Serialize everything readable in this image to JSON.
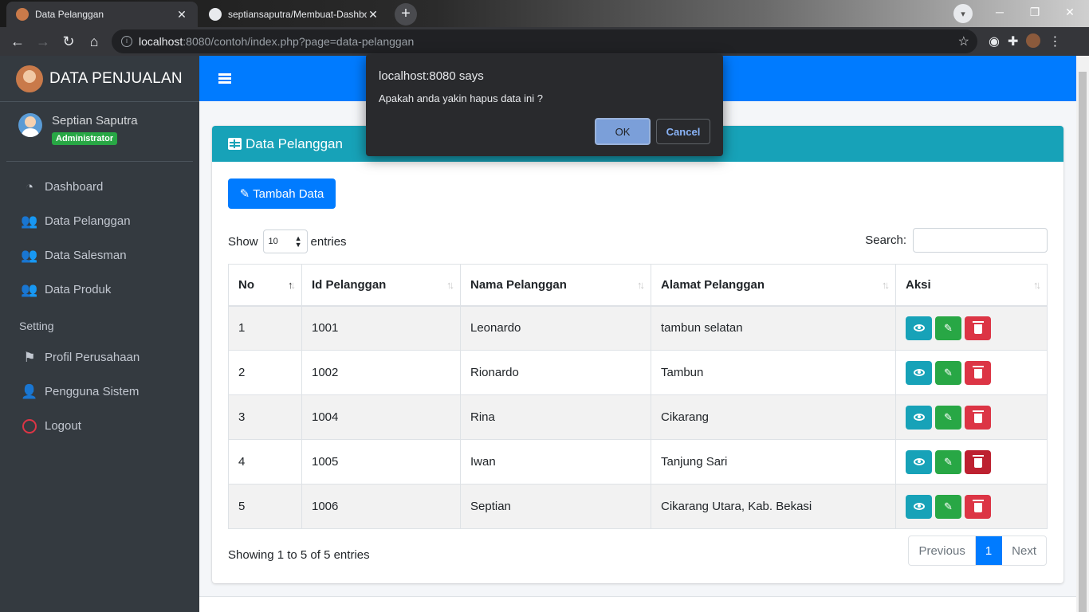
{
  "browser": {
    "tabs": [
      {
        "title": "Data Pelanggan",
        "active": true
      },
      {
        "title": "septiansaputra/Membuat-Dashbo",
        "active": false
      }
    ],
    "new_tab_symbol": "+",
    "url_host": "localhost",
    "url_rest": ":8080/contoh/index.php?page=data-pelanggan"
  },
  "sidebar": {
    "brand": "DATA PENJUALAN",
    "user_name": "Septian Saputra",
    "user_role": "Administrator",
    "menu": [
      {
        "label": "Dashboard",
        "icon": "tachometer-icon"
      },
      {
        "label": "Data Pelanggan",
        "icon": "users-icon"
      },
      {
        "label": "Data Salesman",
        "icon": "users-icon"
      },
      {
        "label": "Data Produk",
        "icon": "users-icon"
      }
    ],
    "setting_header": "Setting",
    "setting_menu": [
      {
        "label": "Profil Perusahaan",
        "icon": "flag-icon"
      },
      {
        "label": "Pengguna Sistem",
        "icon": "user-icon"
      },
      {
        "label": "Logout",
        "icon": "circle-icon"
      }
    ]
  },
  "card": {
    "title": "Data Pelanggan",
    "add_button": "Tambah Data",
    "show_label": "Show",
    "entries_value": "10",
    "entries_label": "entries",
    "search_label": "Search:",
    "search_value": "",
    "columns": [
      "No",
      "Id Pelanggan",
      "Nama Pelanggan",
      "Alamat Pelanggan",
      "Aksi"
    ],
    "rows": [
      {
        "no": "1",
        "id": "1001",
        "nama": "Leonardo",
        "alamat": "tambun selatan"
      },
      {
        "no": "2",
        "id": "1002",
        "nama": "Rionardo",
        "alamat": "Tambun"
      },
      {
        "no": "3",
        "id": "1004",
        "nama": "Rina",
        "alamat": "Cikarang"
      },
      {
        "no": "4",
        "id": "1005",
        "nama": "Iwan",
        "alamat": "Tanjung Sari"
      },
      {
        "no": "5",
        "id": "1006",
        "nama": "Septian",
        "alamat": "Cikarang Utara, Kab. Bekasi"
      }
    ],
    "info": "Showing 1 to 5 of 5 entries",
    "pager": {
      "previous": "Previous",
      "current": "1",
      "next": "Next"
    }
  },
  "dialog": {
    "title": "localhost:8080 says",
    "message": "Apakah anda yakin hapus data ini ?",
    "ok": "OK",
    "cancel": "Cancel"
  },
  "colors": {
    "primary": "#007bff",
    "info": "#17a2b8",
    "success": "#28a745",
    "danger": "#dc3545",
    "sidebar": "#343a40"
  }
}
